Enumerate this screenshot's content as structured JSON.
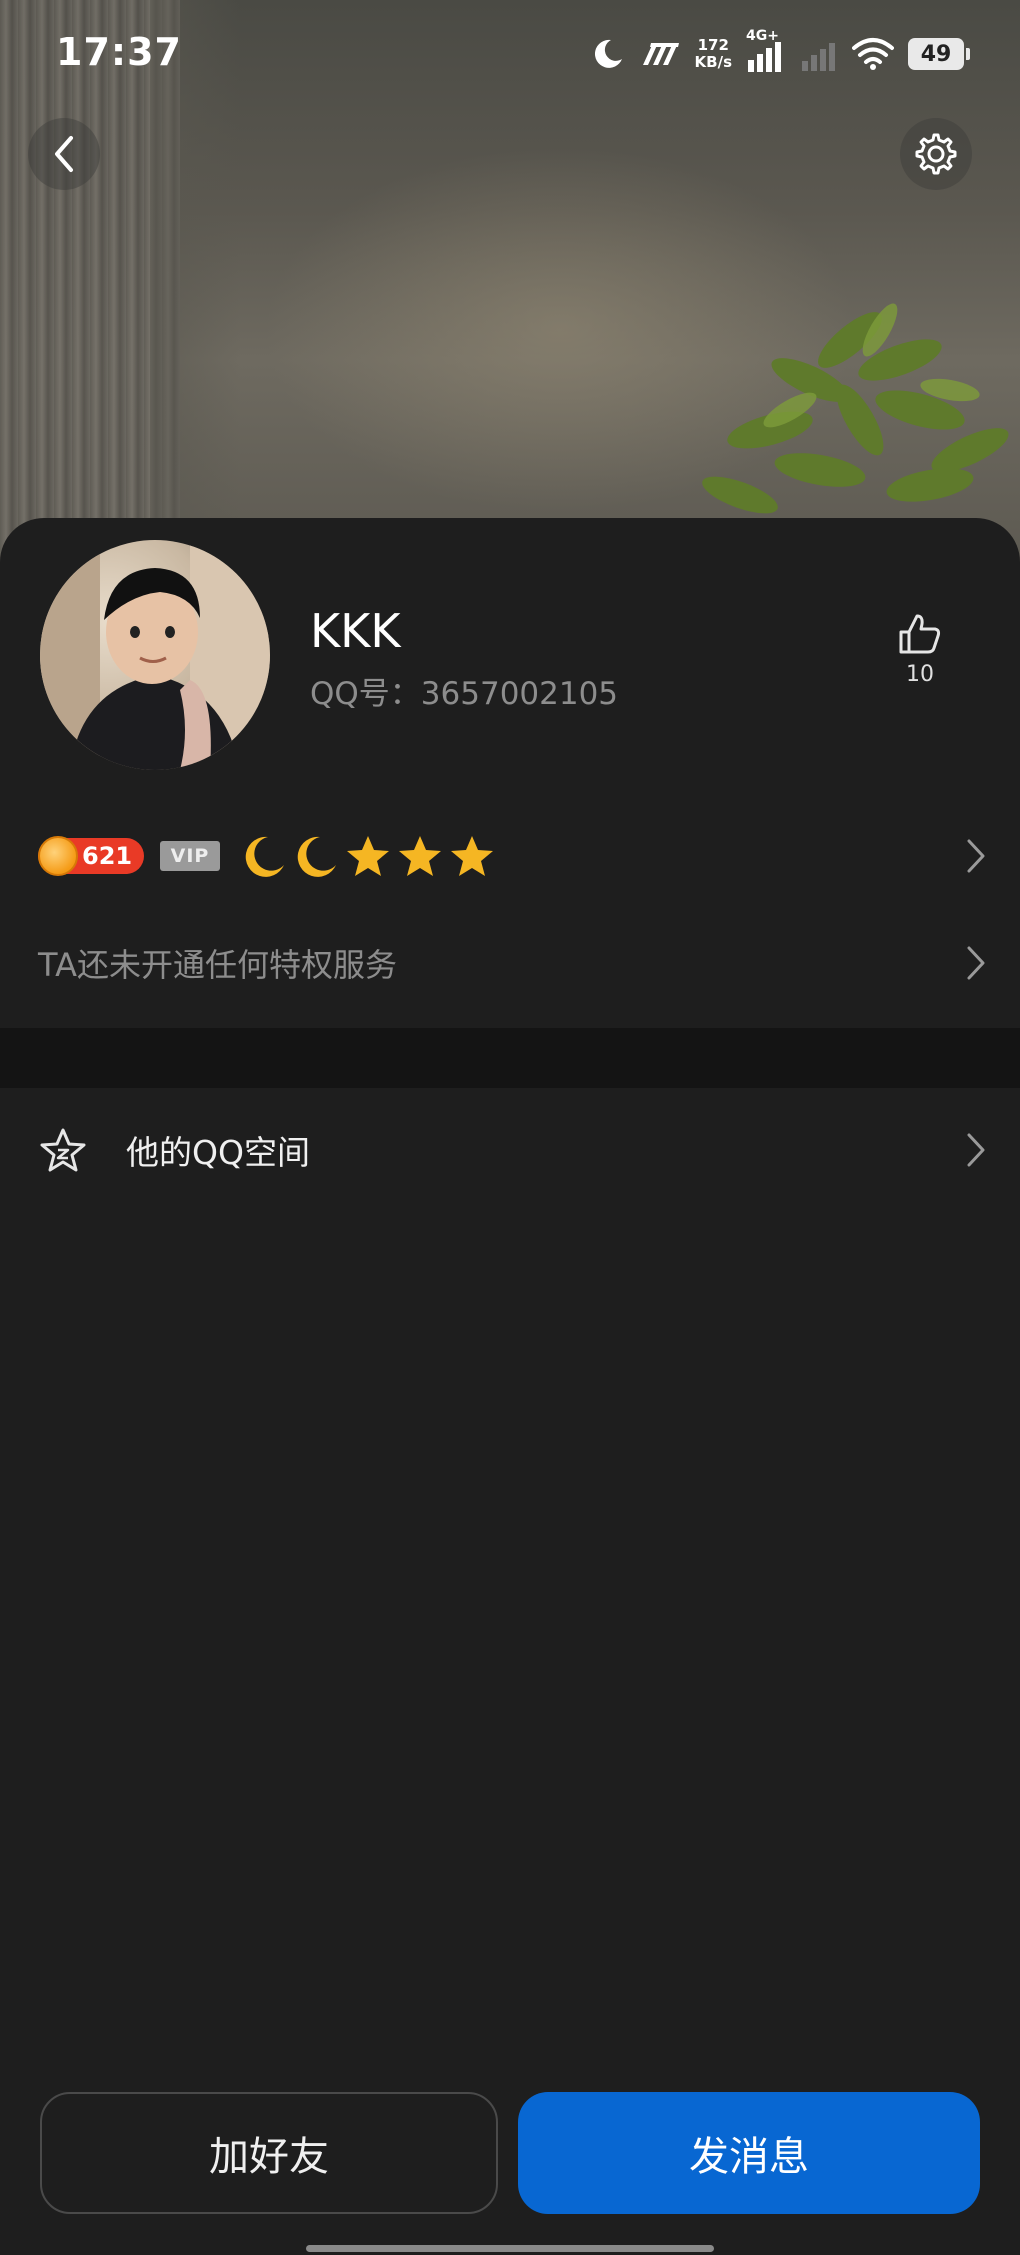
{
  "status_bar": {
    "time": "17:37",
    "net_speed_value": "172",
    "net_speed_unit": "KB/s",
    "network_type": "4G+",
    "battery": "49"
  },
  "profile": {
    "nickname": "KKK",
    "qq_label": "QQ号：3657002105",
    "likes": "10"
  },
  "level": {
    "coin_value": "621",
    "vip_label": "VIP",
    "icons": [
      "moon-icon",
      "moon-icon",
      "star-icon",
      "star-icon",
      "star-icon"
    ]
  },
  "privilege_text": "TA还未开通任何特权服务",
  "qzone_label": "他的QQ空间",
  "buttons": {
    "add_friend": "加好友",
    "send_message": "发消息"
  },
  "colors": {
    "primary_button": "#0867d2",
    "sheet_background": "#1e1e1e",
    "coin_badge": "#e93a26",
    "level_icon": "#f5b623"
  }
}
